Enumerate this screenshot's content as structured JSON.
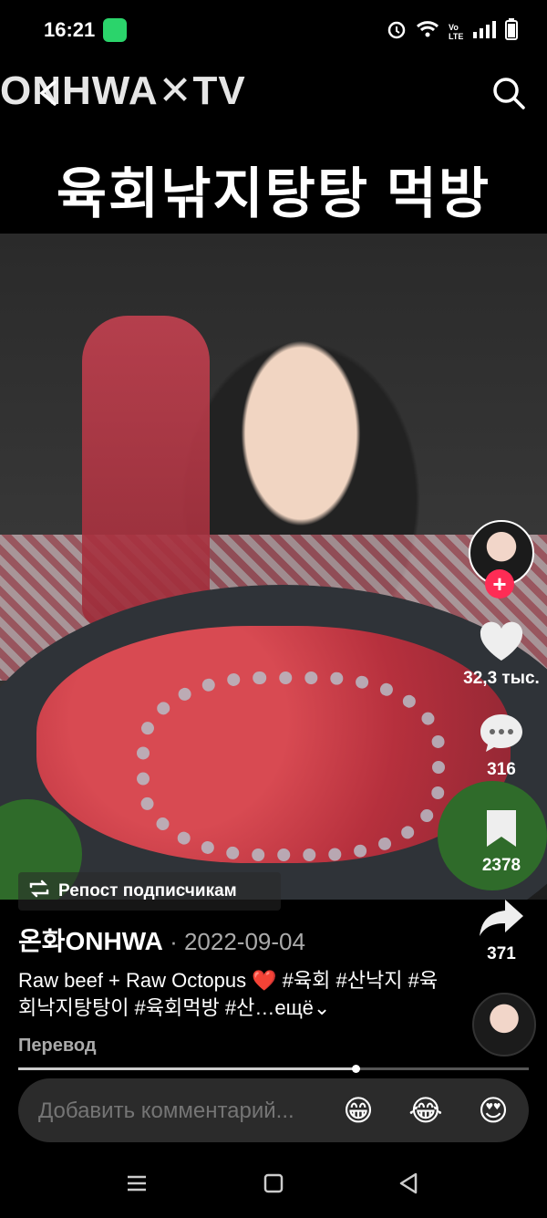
{
  "status_bar": {
    "time": "16:21",
    "icons": [
      "alarm-icon",
      "wifi-icon",
      "volte-icon",
      "signal-icon",
      "battery-icon"
    ],
    "volte_label": "Vo LTE"
  },
  "header": {
    "brand": "ONHWA✕TV",
    "video_title": "육회낚지탕탕 먹방"
  },
  "overlay": {
    "repost_label": "Репост подписчикам"
  },
  "side_actions": {
    "likes": "32,3 тыс.",
    "comments": "316",
    "saves": "2378",
    "shares": "371"
  },
  "post": {
    "username": "온화ONHWA",
    "separator": " · ",
    "date": "2022-09-04",
    "caption": "Raw beef + Raw Octopus ❤️ #육회 #산낙지 #육회낙지탕탕이 #육회먹방 #산…",
    "more": "ещё",
    "translate": "Перевод"
  },
  "progress": {
    "fraction": 0.66
  },
  "comment_bar": {
    "placeholder": "Добавить комментарий...",
    "emojis": [
      "😁",
      "😂",
      "😍"
    ]
  },
  "colors": {
    "follow": "#fe2c55",
    "background": "#000000"
  }
}
